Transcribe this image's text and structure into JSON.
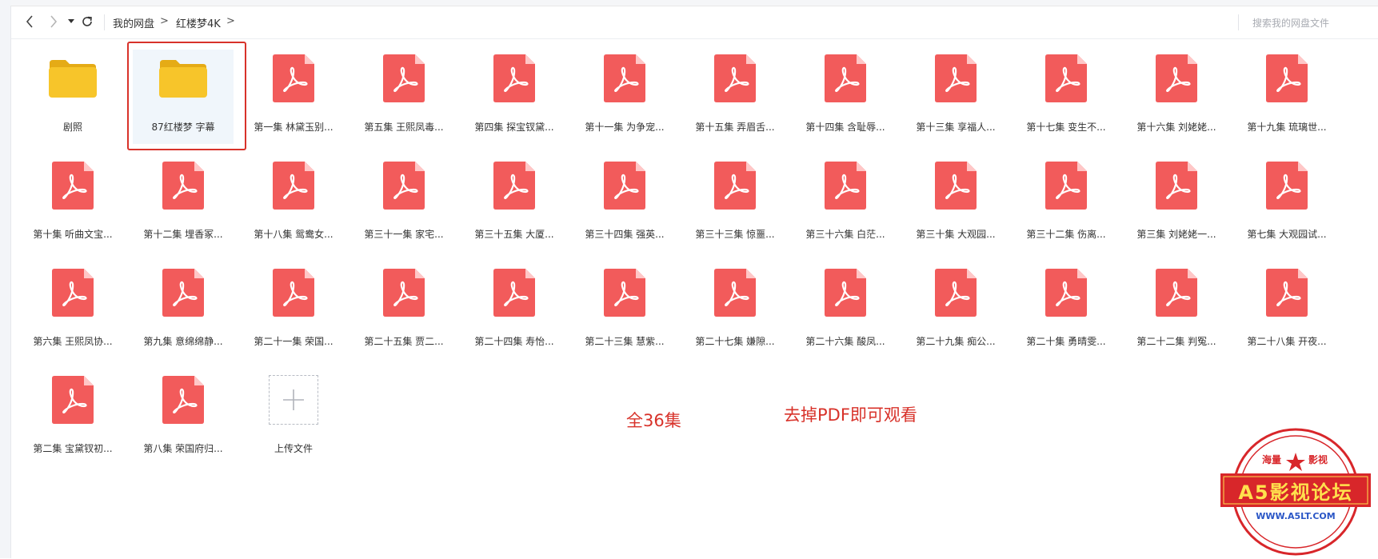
{
  "toolbar": {
    "breadcrumb": [
      {
        "label": "我的网盘"
      },
      {
        "label": "红楼梦4K"
      }
    ],
    "breadcrumb_separator": ">",
    "search_placeholder": "搜索我的网盘文件"
  },
  "items": [
    {
      "type": "folder",
      "name": "剧照"
    },
    {
      "type": "folder",
      "name": "87红楼梦 字幕",
      "selected": true
    },
    {
      "type": "pdf",
      "name": "第一集 林黛玉别..."
    },
    {
      "type": "pdf",
      "name": "第五集 王熙凤毒..."
    },
    {
      "type": "pdf",
      "name": "第四集 探宝钗黛..."
    },
    {
      "type": "pdf",
      "name": "第十一集 为争宠..."
    },
    {
      "type": "pdf",
      "name": "第十五集 弄眉舌..."
    },
    {
      "type": "pdf",
      "name": "第十四集 含耻辱..."
    },
    {
      "type": "pdf",
      "name": "第十三集 享福人..."
    },
    {
      "type": "pdf",
      "name": "第十七集 变生不..."
    },
    {
      "type": "pdf",
      "name": "第十六集 刘姥姥..."
    },
    {
      "type": "pdf",
      "name": "第十九集 琉璃世..."
    },
    {
      "type": "pdf",
      "name": "第十集 听曲文宝..."
    },
    {
      "type": "pdf",
      "name": "第十二集 埋香冢..."
    },
    {
      "type": "pdf",
      "name": "第十八集 鸳鸯女..."
    },
    {
      "type": "pdf",
      "name": "第三十一集 家宅..."
    },
    {
      "type": "pdf",
      "name": "第三十五集 大厦..."
    },
    {
      "type": "pdf",
      "name": "第三十四集 强英..."
    },
    {
      "type": "pdf",
      "name": "第三十三集 惊噩..."
    },
    {
      "type": "pdf",
      "name": "第三十六集 白茫..."
    },
    {
      "type": "pdf",
      "name": "第三十集 大观园..."
    },
    {
      "type": "pdf",
      "name": "第三十二集 伤离..."
    },
    {
      "type": "pdf",
      "name": "第三集 刘姥姥一..."
    },
    {
      "type": "pdf",
      "name": "第七集 大观园试..."
    },
    {
      "type": "pdf",
      "name": "第六集 王熙凤协..."
    },
    {
      "type": "pdf",
      "name": "第九集 意绵绵静..."
    },
    {
      "type": "pdf",
      "name": "第二十一集 荣国..."
    },
    {
      "type": "pdf",
      "name": "第二十五集 贾二..."
    },
    {
      "type": "pdf",
      "name": "第二十四集 寿怡..."
    },
    {
      "type": "pdf",
      "name": "第二十三集 慧紫..."
    },
    {
      "type": "pdf",
      "name": "第二十七集 嫌隙..."
    },
    {
      "type": "pdf",
      "name": "第二十六集 酸凤..."
    },
    {
      "type": "pdf",
      "name": "第二十九集 痴公..."
    },
    {
      "type": "pdf",
      "name": "第二十集 勇晴雯..."
    },
    {
      "type": "pdf",
      "name": "第二十二集 判冤..."
    },
    {
      "type": "pdf",
      "name": "第二十八集 开夜..."
    },
    {
      "type": "pdf",
      "name": "第二集 宝黛钗初..."
    },
    {
      "type": "pdf",
      "name": "第八集 荣国府归..."
    },
    {
      "type": "upload",
      "name": "上传文件"
    }
  ],
  "annotations": {
    "total": "全36集",
    "note": "去掉PDF即可观看"
  },
  "stamp": {
    "top_left": "海量",
    "top_right": "影视",
    "main": "A5影视论坛",
    "url": "WWW.A5LT.COM"
  },
  "colors": {
    "pdf_red": "#f25b5b",
    "folder_yellow": "#f7c52a",
    "annotation_red": "#d8322a",
    "stamp_red": "#d8262a",
    "stamp_yellow": "#ffe14d"
  }
}
